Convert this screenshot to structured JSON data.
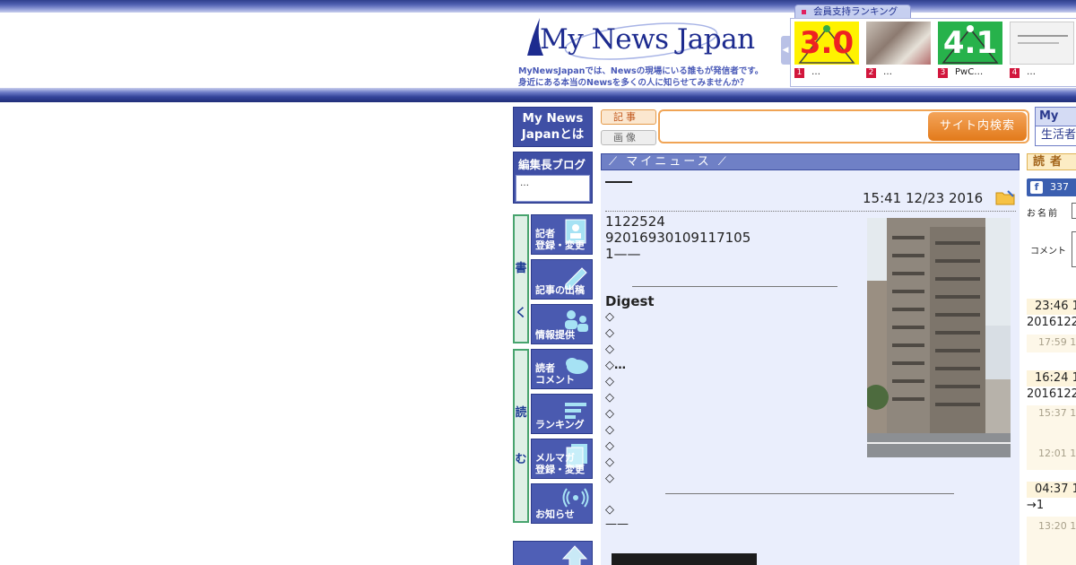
{
  "header": {
    "logo_text": "My News Japan",
    "tagline_line1": "MyNewsJapanでは、Newsの現場にいる誰もが発信者です。",
    "tagline_line2": "身近にある本当のNewsを多くの人に知らせてみませんか？"
  },
  "ranking": {
    "tab_label": "会員支持ランキング",
    "items": [
      {
        "rank": "1",
        "caption": "…",
        "thumb_text": "3.0"
      },
      {
        "rank": "2",
        "caption": "…"
      },
      {
        "rank": "3",
        "caption": "PwC…",
        "thumb_text": "4.1"
      },
      {
        "rank": "4",
        "caption": "…"
      }
    ]
  },
  "nav": {
    "about_line1": "My News",
    "about_line2": "Japanとは",
    "blog_title": "編集長ブログ",
    "blog_preview": "…",
    "write_side": "書く",
    "read_side": "読む",
    "write_buttons": [
      {
        "line1": "記者",
        "line2": "登録・変更"
      },
      {
        "line1": "",
        "line2": "記事の出稿"
      },
      {
        "line1": "",
        "line2": "情報提供"
      }
    ],
    "read_buttons": [
      {
        "line1": "読者",
        "line2": "コメント"
      },
      {
        "line1": "",
        "line2": "ランキング"
      },
      {
        "line1": "メルマガ",
        "line2": "登録・変更"
      },
      {
        "line1": "",
        "line2": "お知らせ"
      }
    ]
  },
  "search": {
    "tab_article": "記事",
    "tab_image": "画像",
    "query": "",
    "button_label": "サイト内検索"
  },
  "article": {
    "section_title": "マイニュース",
    "heading": "——",
    "timestamp": "15:41 12/23 2016",
    "body_lines": [
      "1122524",
      "92016930109117105",
      "1——"
    ],
    "digest_title": "Digest",
    "digest_items": [
      "◇",
      "◇",
      "◇",
      "◇…",
      "◇",
      "◇",
      "◇",
      "◇",
      "◇",
      "◇",
      "◇"
    ],
    "after_item": "◇",
    "end_dash": "——"
  },
  "right": {
    "tab1": "My News",
    "tab2": "生活者",
    "read_header": "読者",
    "fb_count": "337",
    "name_label": "お名前",
    "comment_label": "コメント",
    "comments": [
      {
        "time": "23:46 1",
        "text": "2016122",
        "sub": "17:59 1"
      },
      {
        "time": "16:24 1",
        "text": "2016122",
        "sub": "15:37 1",
        "sub2": "12:01 1"
      },
      {
        "time": "04:37 1",
        "text": "→1",
        "sub": "13:20 1"
      }
    ]
  },
  "colors": {
    "brand_navy": "#2b3a8e",
    "accent_orange": "#e88a2a",
    "panel_bg": "#eaeefc",
    "comment_bg": "#fdf4dc"
  }
}
